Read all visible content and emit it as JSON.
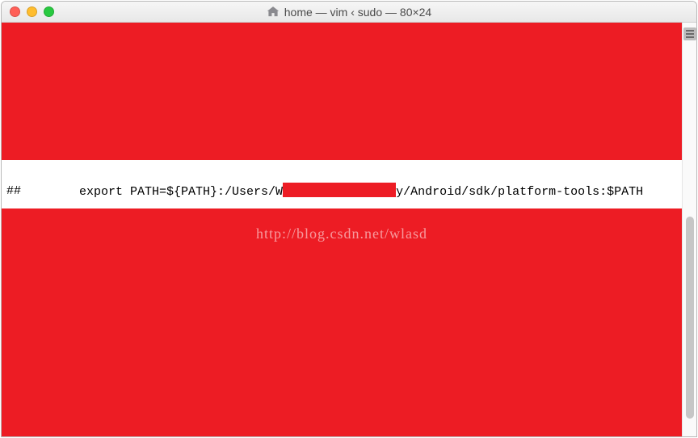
{
  "titlebar": {
    "title": "home — vim ‹ sudo — 80×24"
  },
  "terminal": {
    "line1_start": "export PATH=${PATH}:/Users/W",
    "line1_end": "y/Android/sdk/platform-tools:$PATH",
    "line2": "##"
  },
  "watermark": "http://blog.csdn.net/wlasd"
}
